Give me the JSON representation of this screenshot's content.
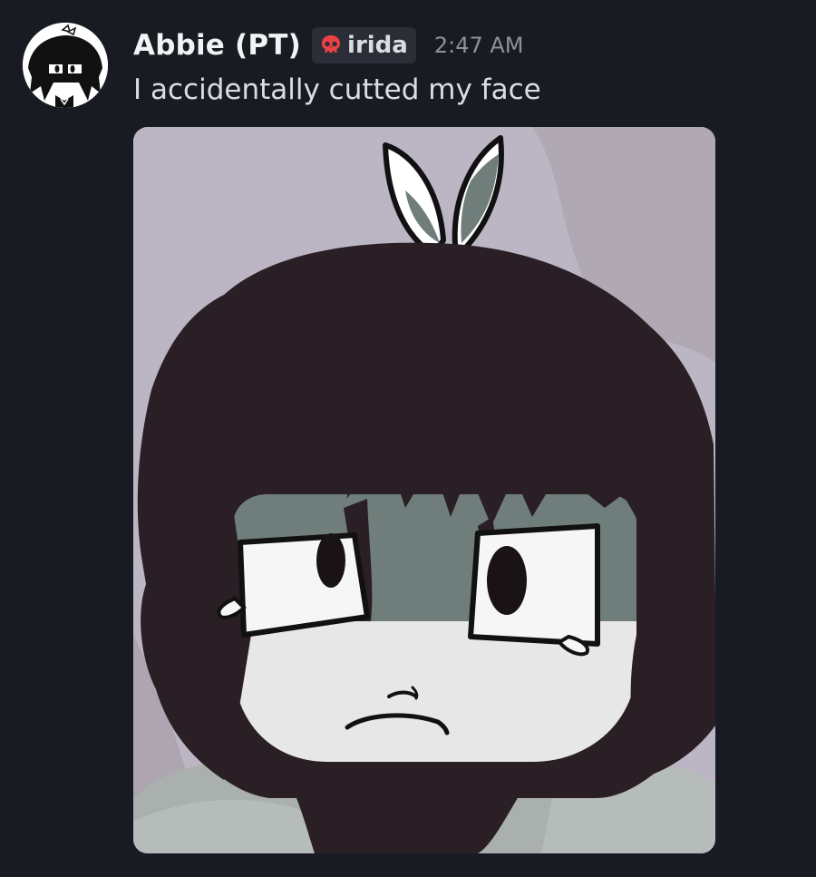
{
  "message": {
    "author": "Abbie (PT)",
    "guild_tag": {
      "icon": "skull-icon",
      "label": "irida"
    },
    "timestamp": "2:47 AM",
    "text": "I accidentally cutted my face",
    "avatar": "avatar-image",
    "attachment": {
      "kind": "image",
      "subject": "cartoon-face-drawing"
    }
  },
  "colors": {
    "background": "#181b22",
    "username": "#f2f3f5",
    "message_text": "#dbdee1",
    "timestamp": "#8e9297",
    "tag_background": "#2b2e36",
    "tag_icon": "#ed4245"
  }
}
